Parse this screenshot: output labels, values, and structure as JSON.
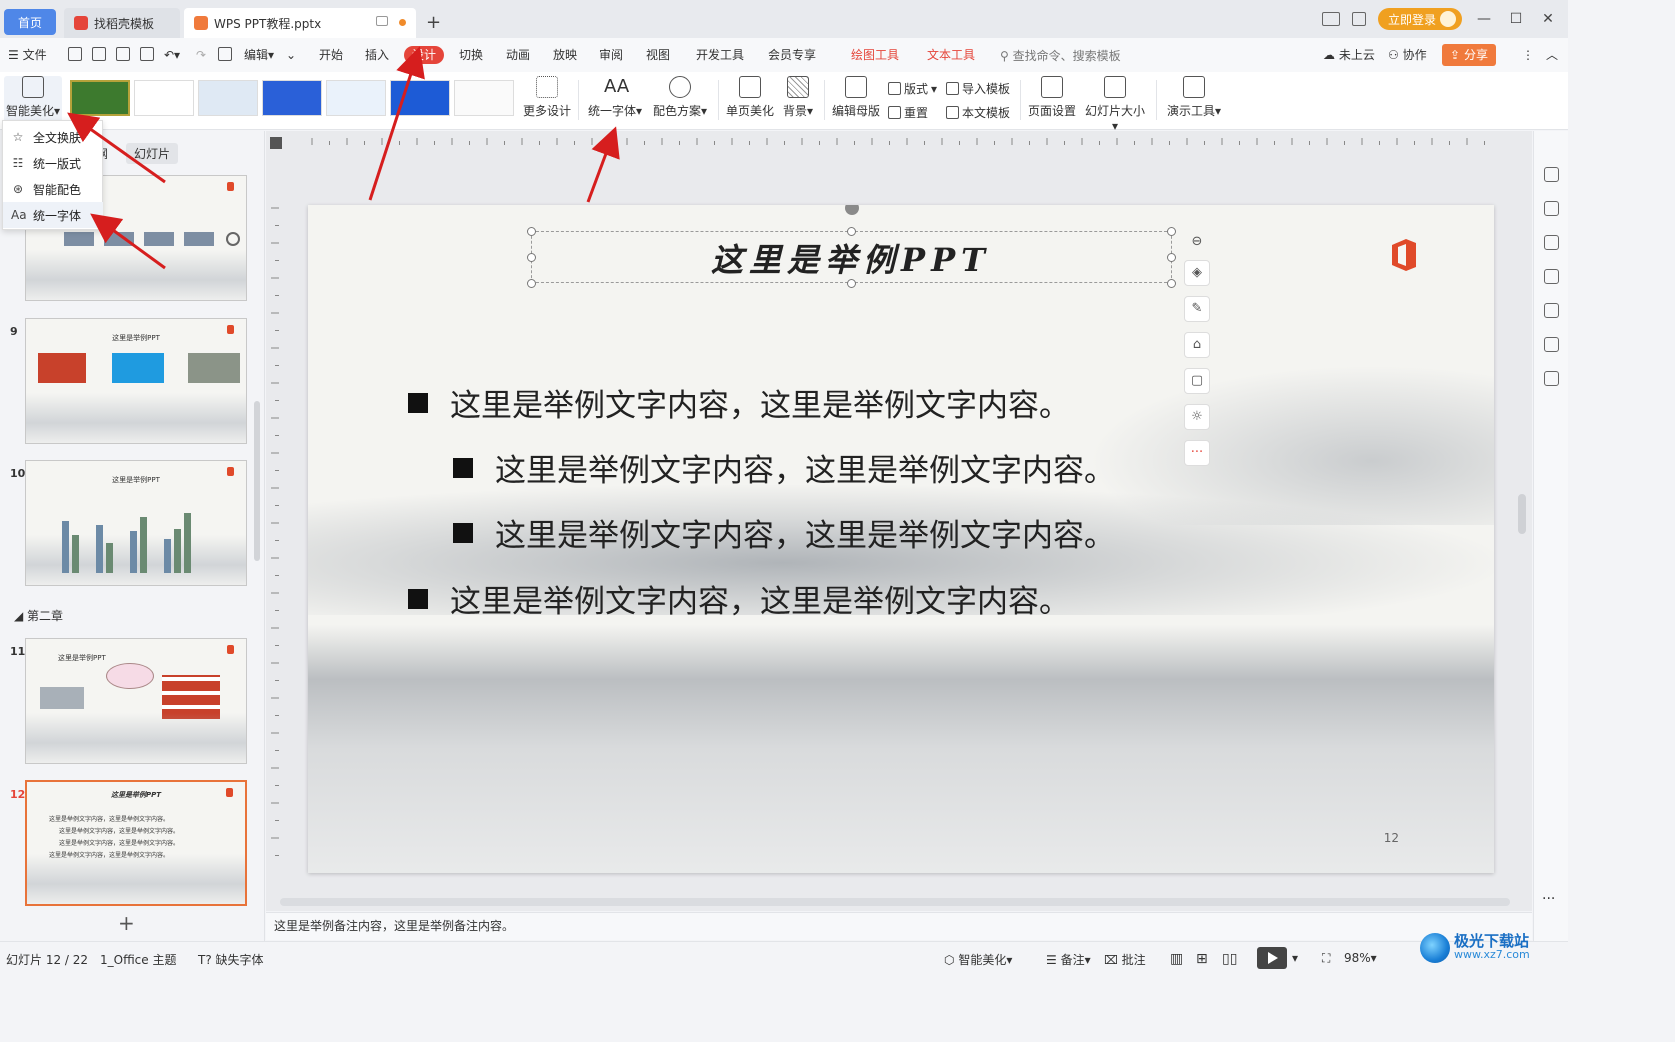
{
  "tabs": [
    {
      "label": "首页"
    },
    {
      "label": "找稻壳模板"
    },
    {
      "label": "WPS PPT教程.pptx"
    }
  ],
  "titlebar": {
    "login_label": "立即登录"
  },
  "menubar": {
    "file": "文件",
    "edit": "编辑",
    "items": [
      "开始",
      "插入",
      "设计",
      "切换",
      "动画",
      "放映",
      "审阅",
      "视图",
      "开发工具",
      "会员专享"
    ],
    "active": "设计",
    "context_tools": [
      "绘图工具",
      "文本工具"
    ],
    "search_placeholder": "查找命令、搜索模板",
    "cloud": "未上云",
    "collab": "协作",
    "share": "分享"
  },
  "ribbon": {
    "smart_beautify": "智能美化",
    "more_design": "更多设计",
    "unify_font": "统一字体",
    "color_scheme": "配色方案",
    "single_page_beautify": "单页美化",
    "background": "背景",
    "edit_master": "编辑母版",
    "layout": "版式",
    "reset": "重置",
    "import_template": "导入模板",
    "this_template": "本文模板",
    "page_setup": "页面设置",
    "slide_size": "幻灯片大小",
    "presentation_tools": "演示工具"
  },
  "dropdown": {
    "items": [
      {
        "label": "全文换肤",
        "icon": "skin-icon"
      },
      {
        "label": "统一版式",
        "icon": "layout-icon"
      },
      {
        "label": "智能配色",
        "icon": "palette-icon"
      },
      {
        "label": "统一字体",
        "icon": "font-icon"
      }
    ]
  },
  "left_panel": {
    "tabs": [
      "纲",
      "幻灯片"
    ],
    "chapter": "第二章",
    "slides": [
      {
        "num": "9",
        "title": "这里是举例PPT"
      },
      {
        "num": "10",
        "title": "这里是举例PPT"
      },
      {
        "num": "11",
        "title": "这里是举例PPT"
      },
      {
        "num": "12",
        "title": "这里是举例PPT"
      }
    ],
    "slide12_lines": [
      "这里是举例文字内容，这里是举例文字内容。",
      "这里是举例文字内容，这里是举例文字内容。",
      "这里是举例文字内容，这里是举例文字内容。",
      "这里是举例文字内容，这里是举例文字内容。"
    ]
  },
  "slide": {
    "title": "这里是举例PPT",
    "bullets": [
      {
        "text": "这里是举例文字内容，这里是举例文字内容。",
        "level": 1
      },
      {
        "text": "这里是举例文字内容，这里是举例文字内容。",
        "level": 2
      },
      {
        "text": "这里是举例文字内容，这里是举例文字内容。",
        "level": 2
      },
      {
        "text": "这里是举例文字内容，这里是举例文字内容。",
        "level": 1
      }
    ],
    "page_number": "12"
  },
  "notes": {
    "text": "这里是举例备注内容，这里是举例备注内容。"
  },
  "statusbar": {
    "slide_info": "幻灯片 12 / 22",
    "theme": "1_Office 主题",
    "missing_font": "缺失字体",
    "smart_beautify": "智能美化",
    "notes": "备注",
    "comments": "批注",
    "zoom": "98%"
  },
  "watermark": {
    "line1": "极光下载站",
    "line2": "www.xz7.com"
  },
  "colors": {
    "accent": "#e5453a",
    "home_tab": "#4f87e8",
    "login": "#f0a020",
    "share": "#f07a3c",
    "selected_slide": "#e8733a"
  }
}
